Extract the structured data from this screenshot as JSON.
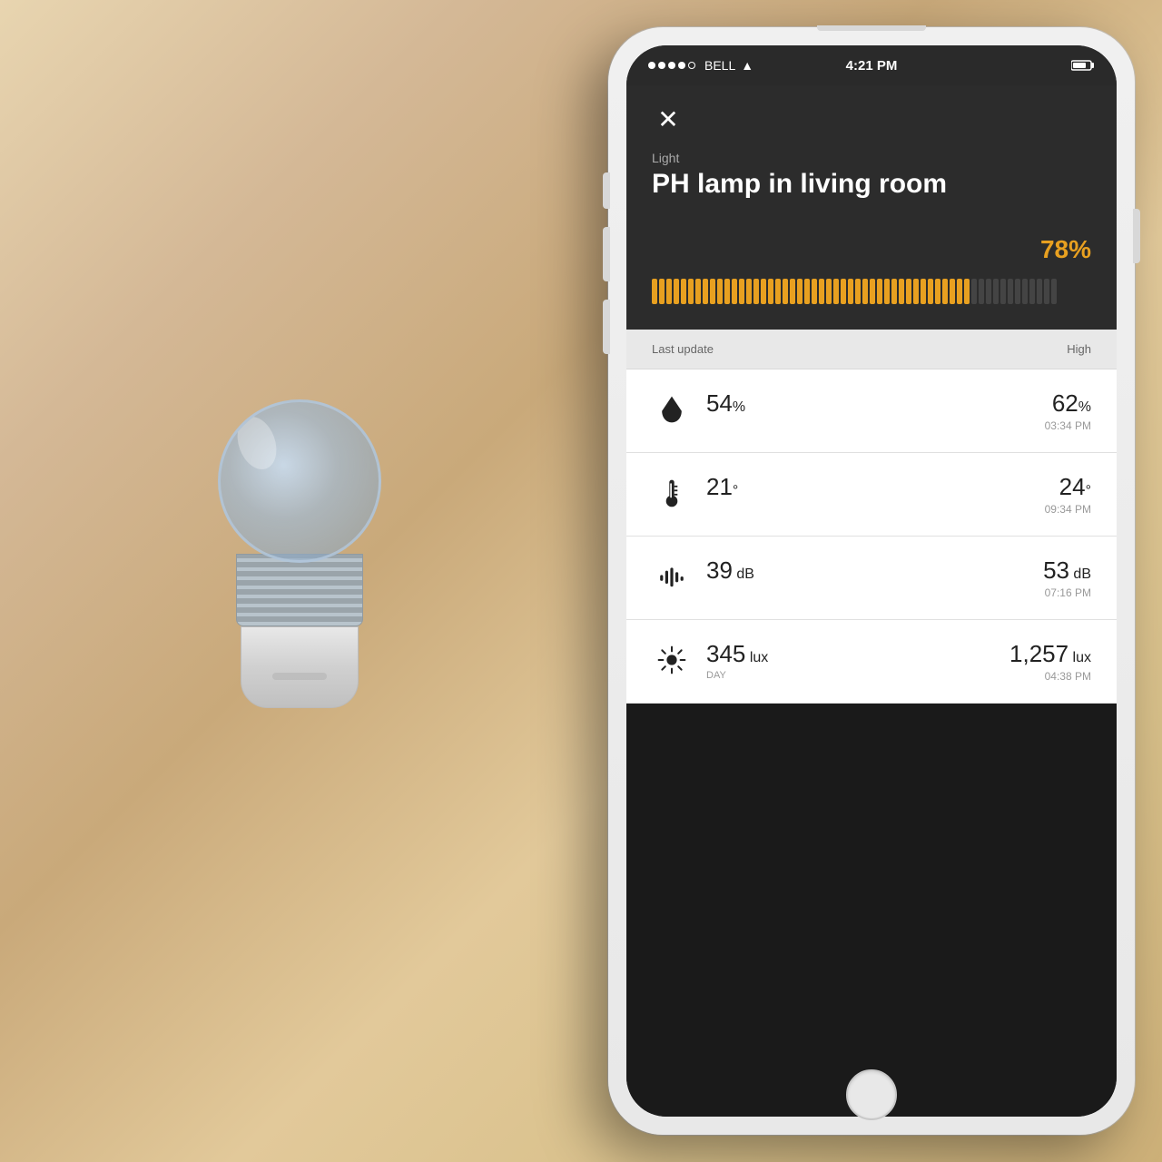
{
  "background": {
    "color": "#d4b896"
  },
  "status_bar": {
    "carrier": "BELL",
    "signal_dots": [
      {
        "filled": true
      },
      {
        "filled": true
      },
      {
        "filled": true
      },
      {
        "filled": true
      },
      {
        "filled": false
      }
    ],
    "wifi": "wifi",
    "time": "4:21 PM"
  },
  "app": {
    "close_button_label": "✕",
    "device_category": "Light",
    "device_name": "PH lamp in living room",
    "brightness_percent": "78%",
    "brightness_fill_ratio": 0.78,
    "stats_header": {
      "col1": "Last update",
      "col2": "High"
    },
    "stats": [
      {
        "id": "humidity",
        "icon_type": "drop",
        "current_value": "54",
        "current_unit": "%",
        "current_label": "",
        "high_value": "62",
        "high_unit": "%",
        "high_time": "03:34 PM"
      },
      {
        "id": "temperature",
        "icon_type": "thermometer",
        "current_value": "21",
        "current_unit": "°",
        "current_label": "",
        "high_value": "24",
        "high_unit": "°",
        "high_time": "09:34 PM"
      },
      {
        "id": "noise",
        "icon_type": "sound",
        "current_value": "39",
        "current_unit": " dB",
        "current_label": "",
        "high_value": "53",
        "high_unit": " dB",
        "high_time": "07:16 PM"
      },
      {
        "id": "light",
        "icon_type": "sun",
        "current_value": "345",
        "current_unit": " lux",
        "current_label": "DAY",
        "high_value": "1,257",
        "high_unit": " lux",
        "high_time": "04:38 PM"
      }
    ]
  }
}
